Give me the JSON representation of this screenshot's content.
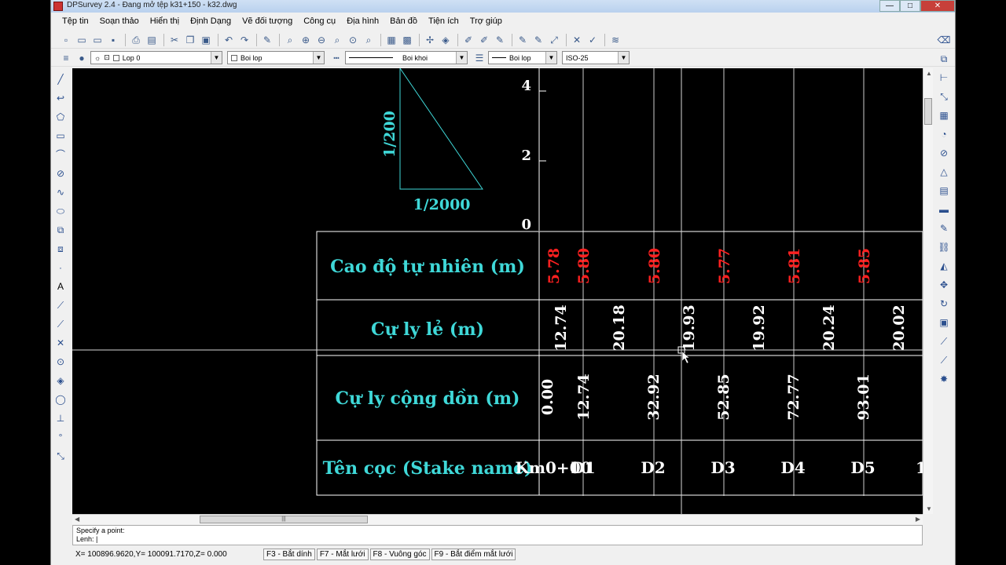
{
  "window": {
    "title": "DPSurvey 2.4 - Đang mở tệp k31+150 - k32.dwg",
    "btn_min": "—",
    "btn_max": "□",
    "btn_close": "✕"
  },
  "menu": [
    "Tệp tin",
    "Soạn thảo",
    "Hiển thị",
    "Định Dạng",
    "Vẽ đối tượng",
    "Công cụ",
    "Địa hình",
    "Bản đồ",
    "Tiện ích",
    "Trợ giúp"
  ],
  "layers": {
    "layer_combo": "Lop 0",
    "color_combo": "Boi lop",
    "linetype_combo": "Boi khoi",
    "lineweight_combo": "Boi lop",
    "dimstyle_combo": "ISO-25"
  },
  "drawing": {
    "scale_vertical": "1/200",
    "scale_horizontal": "1/2000",
    "y_ticks": [
      "4",
      "2",
      "0"
    ],
    "row_labels": [
      "Cao độ tự nhiên (m)",
      "Cự ly lẻ (m)",
      "Cự ly cộng dồn (m)",
      "Tên cọc (Stake name)"
    ],
    "elevations": [
      "5.78",
      "5.80",
      "5.80",
      "5.77",
      "5.81",
      "5.85"
    ],
    "segment_distances": [
      "12.74",
      "20.18",
      "19.93",
      "19.92",
      "20.24",
      "20.02"
    ],
    "cumulative_distances": [
      "0.00",
      "12.74",
      "32.92",
      "52.85",
      "72.77",
      "93.01"
    ],
    "stake_names": [
      "Km0+00",
      "D1",
      "D2",
      "D3",
      "D4",
      "D5"
    ],
    "stake_partial": "1"
  },
  "colors": {
    "canvas": "#000000",
    "cyan_text": "#3fd8d8",
    "red_text": "#ff2020",
    "white_text": "#ffffff"
  },
  "command": {
    "prompt": "Specify a point:",
    "input_label": "Lenh:",
    "input_value": "|"
  },
  "status": {
    "coords": "X= 100896.9620,Y= 100091.7170,Z= 0.000",
    "buttons": [
      "F3 - Bắt dính",
      "F7 - Mắt lưới",
      "F8 - Vuông góc",
      "F9 - Bắt điểm mắt lưới"
    ]
  }
}
